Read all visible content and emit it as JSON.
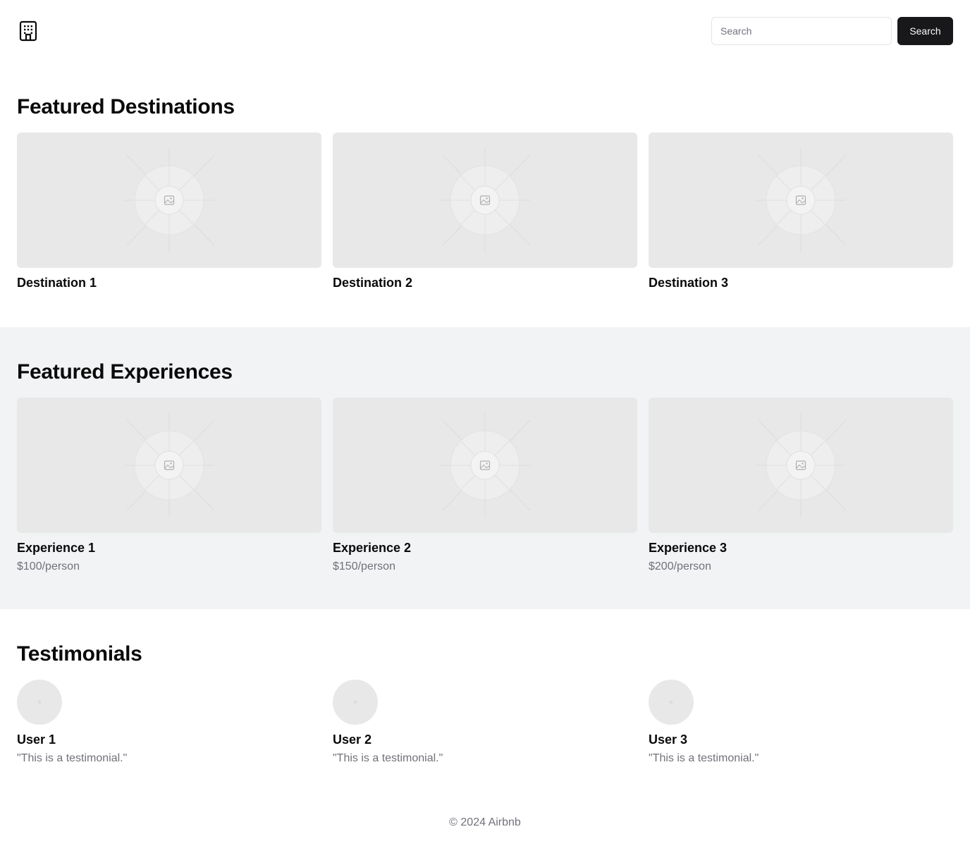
{
  "header": {
    "logo_icon": "building-icon",
    "search": {
      "placeholder": "Search",
      "value": ""
    },
    "search_button_label": "Search"
  },
  "destinations": {
    "title": "Featured Destinations",
    "items": [
      {
        "name": "Destination 1",
        "image_icon": "image-placeholder-icon"
      },
      {
        "name": "Destination 2",
        "image_icon": "image-placeholder-icon"
      },
      {
        "name": "Destination 3",
        "image_icon": "image-placeholder-icon"
      }
    ]
  },
  "experiences": {
    "title": "Featured Experiences",
    "items": [
      {
        "name": "Experience 1",
        "price": "$100/person",
        "image_icon": "image-placeholder-icon"
      },
      {
        "name": "Experience 2",
        "price": "$150/person",
        "image_icon": "image-placeholder-icon"
      },
      {
        "name": "Experience 3",
        "price": "$200/person",
        "image_icon": "image-placeholder-icon"
      }
    ]
  },
  "testimonials": {
    "title": "Testimonials",
    "items": [
      {
        "user": "User 1",
        "quote": "\"This is a testimonial.\""
      },
      {
        "user": "User 2",
        "quote": "\"This is a testimonial.\""
      },
      {
        "user": "User 3",
        "quote": "\"This is a testimonial.\""
      }
    ]
  },
  "footer": {
    "copyright": "© 2024 Airbnb"
  },
  "colors": {
    "primary_button": "#18181b",
    "muted_text": "#71717a",
    "alt_section_bg": "#f1f3f5",
    "placeholder_bg": "#e8e8e8"
  }
}
